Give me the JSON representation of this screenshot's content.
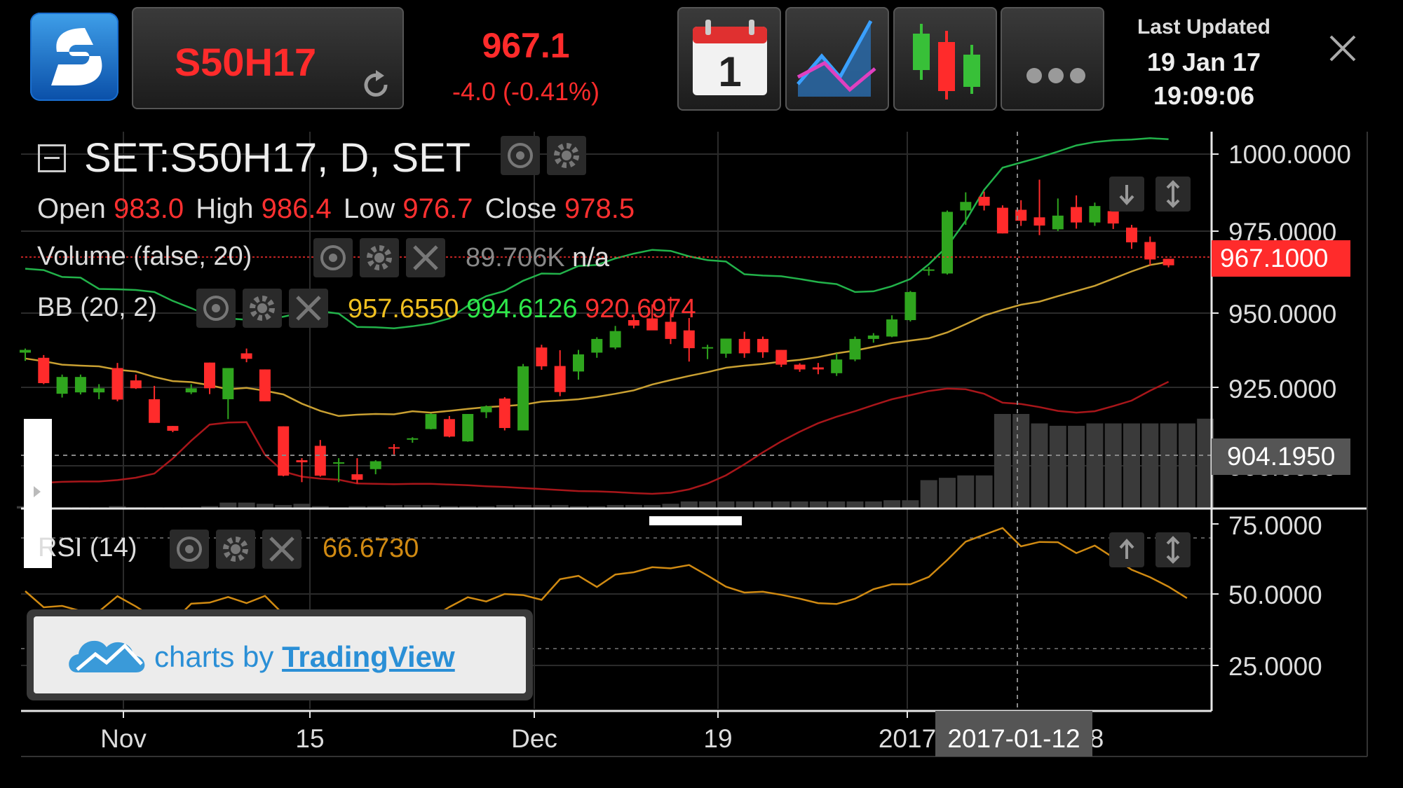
{
  "header": {
    "symbol": "S50H17",
    "price": "967.1",
    "change": "-4.0 (-0.41%)",
    "last_updated_label": "Last Updated",
    "last_updated_date": "19 Jan 17",
    "last_updated_time": "19:09:06",
    "calendar_day": "1"
  },
  "chart": {
    "title": "SET:S50H17, D, SET",
    "ohlc": {
      "open_label": "Open",
      "open": "983.0",
      "high_label": "High",
      "high": "986.4",
      "low_label": "Low",
      "low": "976.7",
      "close_label": "Close",
      "close": "978.5"
    },
    "volume_label": "Volume (false, 20)",
    "volume_value": "89.706K",
    "volume_extra": "n/a",
    "bb_label": "BB (20, 2)",
    "bb_mid": "957.6550",
    "bb_upper": "994.6126",
    "bb_lower": "920.6974",
    "rsi_label": "RSI (14)",
    "rsi_value": "66.6730",
    "price_axis": [
      "1000.0000",
      "975.0000",
      "950.0000",
      "925.0000",
      "900.0000"
    ],
    "rsi_axis": [
      "75.0000",
      "50.0000",
      "25.0000"
    ],
    "current_price_tag": "967.1000",
    "crosshair_price_tag": "904.1950",
    "time_axis": [
      "Nov",
      "15",
      "Dec",
      "19",
      "2017",
      "8"
    ],
    "crosshair_date": "2017-01-12",
    "branding_prefix": "charts by",
    "branding_link": "TradingView"
  },
  "colors": {
    "up": "#2fa51e",
    "down": "#ff2b2b",
    "bb_upper": "#22b24a",
    "bb_mid": "#c9a032",
    "bb_lower": "#a8161a",
    "rsi": "#d08a12",
    "volume": "#3a3a3a",
    "text_red": "#ff3030",
    "text_yellow": "#f0c020",
    "text_green": "#2ee84a"
  },
  "chart_data": {
    "type": "candlestick",
    "title": "SET:S50H17, D, SET",
    "x_ticks": [
      "Nov",
      "15",
      "Dec",
      "19",
      "2017",
      "8"
    ],
    "ylim": [
      895,
      1005
    ],
    "rsi_ylim": [
      12,
      83
    ],
    "candles": [
      {
        "o": 940.5,
        "h": 941.7,
        "l": 938.1,
        "c": 941.3
      },
      {
        "o": 939.0,
        "h": 939.8,
        "l": 931.3,
        "c": 931.6
      },
      {
        "o": 928.5,
        "h": 934.1,
        "l": 927.4,
        "c": 933.4
      },
      {
        "o": 928.9,
        "h": 934.1,
        "l": 928.3,
        "c": 933.4
      },
      {
        "o": 928.9,
        "h": 931.3,
        "l": 926.9,
        "c": 930.1
      },
      {
        "o": 936.0,
        "h": 937.5,
        "l": 926.3,
        "c": 926.8
      },
      {
        "o": 932.4,
        "h": 934.1,
        "l": 929.9,
        "c": 930.1
      },
      {
        "o": 926.9,
        "h": 930.8,
        "l": 920.0,
        "c": 920.0
      },
      {
        "o": 919.1,
        "h": 919.1,
        "l": 917.3,
        "c": 917.7
      },
      {
        "o": 928.9,
        "h": 931.3,
        "l": 928.4,
        "c": 930.1
      },
      {
        "o": 937.6,
        "h": 937.6,
        "l": 928.4,
        "c": 930.1
      },
      {
        "o": 926.9,
        "h": 936.0,
        "l": 921.1,
        "c": 936.0
      },
      {
        "o": 940.3,
        "h": 941.7,
        "l": 937.7,
        "c": 938.7
      },
      {
        "o": 935.6,
        "h": 935.6,
        "l": 926.3,
        "c": 926.3
      },
      {
        "o": 919.0,
        "h": 919.0,
        "l": 904.4,
        "c": 904.6
      },
      {
        "o": 909.1,
        "h": 909.7,
        "l": 902.7,
        "c": 908.5
      },
      {
        "o": 913.3,
        "h": 915.0,
        "l": 904.3,
        "c": 904.6
      },
      {
        "o": 908.3,
        "h": 909.7,
        "l": 902.7,
        "c": 908.5
      },
      {
        "o": 905.0,
        "h": 909.7,
        "l": 902.3,
        "c": 903.4
      },
      {
        "o": 906.5,
        "h": 909.1,
        "l": 905.0,
        "c": 908.8
      },
      {
        "o": 912.9,
        "h": 913.8,
        "l": 910.8,
        "c": 912.6
      },
      {
        "o": 915.1,
        "h": 915.8,
        "l": 914.2,
        "c": 915.5
      },
      {
        "o": 918.2,
        "h": 922.8,
        "l": 918.1,
        "c": 922.6
      },
      {
        "o": 921.1,
        "h": 922.0,
        "l": 915.8,
        "c": 916.0
      },
      {
        "o": 914.6,
        "h": 922.6,
        "l": 914.5,
        "c": 922.6
      },
      {
        "o": 923.1,
        "h": 925.1,
        "l": 921.4,
        "c": 924.8
      },
      {
        "o": 927.1,
        "h": 927.5,
        "l": 917.8,
        "c": 918.5
      },
      {
        "o": 917.8,
        "h": 937.2,
        "l": 917.8,
        "c": 936.5
      },
      {
        "o": 942.0,
        "h": 942.8,
        "l": 935.5,
        "c": 936.5
      },
      {
        "o": 936.6,
        "h": 941.2,
        "l": 927.8,
        "c": 929.0
      },
      {
        "o": 935.0,
        "h": 941.3,
        "l": 932.6,
        "c": 940.0
      },
      {
        "o": 940.5,
        "h": 945.0,
        "l": 939.0,
        "c": 944.5
      },
      {
        "o": 942.0,
        "h": 948.3,
        "l": 941.5,
        "c": 946.8
      },
      {
        "o": 950.0,
        "h": 951.4,
        "l": 947.6,
        "c": 948.4
      },
      {
        "o": 950.5,
        "h": 954.6,
        "l": 947.5,
        "c": 947.0
      },
      {
        "o": 949.5,
        "h": 956.8,
        "l": 943.0,
        "c": 944.5
      },
      {
        "o": 947.0,
        "h": 950.6,
        "l": 937.9,
        "c": 941.8
      },
      {
        "o": 942.1,
        "h": 942.8,
        "l": 938.6,
        "c": 942.1
      },
      {
        "o": 940.2,
        "h": 943.8,
        "l": 939.0,
        "c": 944.6
      },
      {
        "o": 944.5,
        "h": 946.6,
        "l": 939.0,
        "c": 940.3
      },
      {
        "o": 944.5,
        "h": 945.2,
        "l": 939.0,
        "c": 940.6
      },
      {
        "o": 941.3,
        "h": 941.3,
        "l": 936.3,
        "c": 937.0
      },
      {
        "o": 937.0,
        "h": 937.4,
        "l": 934.9,
        "c": 935.6
      },
      {
        "o": 936.2,
        "h": 937.5,
        "l": 934.2,
        "c": 935.6
      },
      {
        "o": 934.5,
        "h": 940.3,
        "l": 933.7,
        "c": 938.5
      },
      {
        "o": 938.5,
        "h": 945.2,
        "l": 938.0,
        "c": 944.5
      },
      {
        "o": 944.5,
        "h": 946.2,
        "l": 943.4,
        "c": 945.5
      },
      {
        "o": 945.2,
        "h": 951.4,
        "l": 945.0,
        "c": 950.2
      },
      {
        "o": 950.0,
        "h": 958.5,
        "l": 949.6,
        "c": 958.2
      },
      {
        "o": 964.5,
        "h": 965.5,
        "l": 963.0,
        "c": 964.8
      },
      {
        "o": 963.6,
        "h": 982.0,
        "l": 963.3,
        "c": 981.6
      },
      {
        "o": 982.0,
        "h": 987.3,
        "l": 977.8,
        "c": 984.5
      },
      {
        "o": 986.0,
        "h": 987.5,
        "l": 982.0,
        "c": 983.4
      },
      {
        "o": 982.8,
        "h": 983.5,
        "l": 975.3,
        "c": 975.3
      },
      {
        "o": 982.2,
        "h": 985.0,
        "l": 977.5,
        "c": 979.0
      },
      {
        "o": 980.0,
        "h": 991.0,
        "l": 974.8,
        "c": 977.6
      },
      {
        "o": 976.5,
        "h": 985.5,
        "l": 976.0,
        "c": 980.5
      },
      {
        "o": 983.0,
        "h": 986.4,
        "l": 976.7,
        "c": 978.5
      },
      {
        "o": 978.5,
        "h": 984.3,
        "l": 977.5,
        "c": 983.3
      },
      {
        "o": 981.8,
        "h": 981.9,
        "l": 976.6,
        "c": 978.2
      },
      {
        "o": 977.0,
        "h": 977.8,
        "l": 970.8,
        "c": 972.7
      },
      {
        "o": 972.8,
        "h": 974.4,
        "l": 966.0,
        "c": 967.7
      },
      {
        "o": 967.9,
        "h": 967.9,
        "l": 965.4,
        "c": 966.0
      }
    ],
    "bb_upper": [
      965.0,
      964.6,
      962.6,
      962.4,
      959.1,
      959.0,
      958.8,
      958.2,
      955.6,
      953.5,
      951.1,
      950.5,
      950.1,
      950.2,
      951.0,
      952.2,
      952.6,
      951.9,
      948.0,
      947.9,
      947.6,
      948.2,
      949.0,
      950.5,
      954.2,
      957.0,
      958.5,
      961.5,
      963.6,
      963.5,
      965.8,
      966.1,
      968.0,
      969.4,
      970.5,
      970.2,
      968.6,
      967.5,
      967.1,
      963.4,
      963.0,
      962.8,
      962.0,
      961.1,
      960.5,
      958.2,
      958.4,
      959.9,
      962.0,
      966.3,
      971.5,
      979.0,
      988.0,
      994.5,
      996.0,
      997.5,
      999.2,
      1001.0,
      1002.0,
      1002.5,
      1002.7,
      1003.1,
      1002.8
    ],
    "bb_mid": [
      938.8,
      938.0,
      937.0,
      936.7,
      936.5,
      935.5,
      935.0,
      933.4,
      932.2,
      931.9,
      931.0,
      929.8,
      930.2,
      929.4,
      928.3,
      925.6,
      923.5,
      922.0,
      922.4,
      922.6,
      922.5,
      923.4,
      923.0,
      923.5,
      924.1,
      924.6,
      924.9,
      925.3,
      926.2,
      926.5,
      926.9,
      927.6,
      928.5,
      929.5,
      931.2,
      932.5,
      933.7,
      934.8,
      936.1,
      936.7,
      937.2,
      937.9,
      938.4,
      939.2,
      940.3,
      941.1,
      942.2,
      943.3,
      944.0,
      944.7,
      946.4,
      948.8,
      951.3,
      953.0,
      954.5,
      955.4,
      957.0,
      958.5,
      960.0,
      962.1,
      964.2,
      966.1,
      967.0
    ],
    "bb_lower": [
      902.5,
      902.5,
      902.8,
      902.9,
      902.9,
      903.3,
      904.0,
      905.2,
      909.6,
      914.8,
      919.5,
      920.1,
      920.2,
      910.7,
      905.8,
      904.3,
      903.7,
      903.4,
      902.3,
      902.2,
      902.1,
      902.2,
      902.2,
      902.0,
      901.8,
      901.5,
      901.3,
      901.0,
      900.7,
      900.4,
      900.1,
      900.0,
      899.8,
      899.5,
      899.3,
      899.6,
      900.6,
      902.3,
      904.7,
      907.9,
      911.4,
      914.6,
      917.4,
      919.9,
      921.8,
      923.4,
      925.2,
      926.9,
      928.1,
      929.3,
      930.0,
      929.8,
      928.5,
      925.9,
      925.5,
      924.6,
      923.5,
      923.0,
      923.4,
      924.9,
      926.5,
      929.4,
      932.0
    ],
    "rsi": [
      54.3,
      48.5,
      49.0,
      47.2,
      47.0,
      52.5,
      48.8,
      44.6,
      43.2,
      49.8,
      50.2,
      52.2,
      50.0,
      52.6,
      46.0,
      38.9,
      39.4,
      38.6,
      39.2,
      40.1,
      38.6,
      40.1,
      44.6,
      48.6,
      52.1,
      50.6,
      53.3,
      52.9,
      51.2,
      58.6,
      59.8,
      55.8,
      60.3,
      61.1,
      62.9,
      62.5,
      63.7,
      59.9,
      55.9,
      53.8,
      54.1,
      53.0,
      51.6,
      50.0,
      49.7,
      51.6,
      55.0,
      56.8,
      56.8,
      59.4,
      65.5,
      72.1,
      74.6,
      77.0,
      70.4,
      72.0,
      71.9,
      68.0,
      70.7,
      66.4,
      62.0,
      59.3,
      55.9,
      51.8
    ],
    "volume": [
      2,
      1,
      1,
      1,
      1,
      2,
      1,
      1,
      1,
      1,
      2,
      5,
      5,
      4,
      3,
      4,
      2,
      1,
      2,
      2,
      3,
      3,
      3,
      2,
      2,
      2,
      3,
      3,
      3,
      3,
      2,
      2,
      3,
      3,
      3,
      4,
      6,
      6,
      6,
      6,
      6,
      6,
      6,
      6,
      6,
      6,
      6,
      7,
      7,
      24,
      26,
      28,
      28,
      80,
      80,
      72,
      70,
      70,
      72,
      72,
      72,
      72,
      72,
      72,
      76
    ]
  }
}
